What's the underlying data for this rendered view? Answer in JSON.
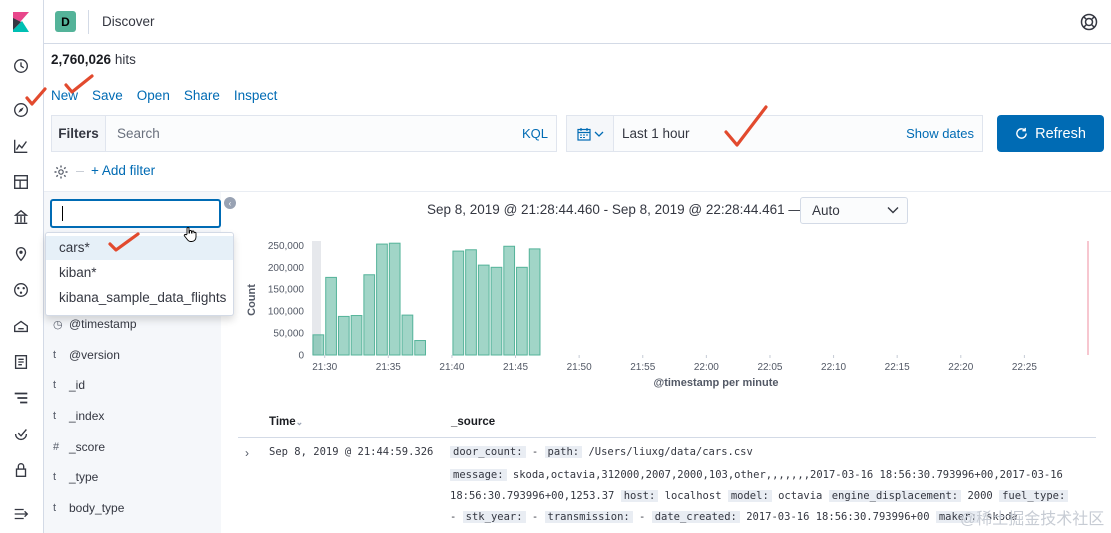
{
  "header": {
    "space_initial": "D",
    "title": "Discover"
  },
  "hits": {
    "count": "2,760,026",
    "label": "hits"
  },
  "menu": {
    "new": "New",
    "save": "Save",
    "open": "Open",
    "share": "Share",
    "inspect": "Inspect"
  },
  "query": {
    "filters_label": "Filters",
    "placeholder": "Search",
    "kql": "KQL"
  },
  "time": {
    "value": "Last 1 hour",
    "show_dates": "Show dates",
    "refresh": "Refresh"
  },
  "add_filter": "+ Add filter",
  "index_popover": {
    "options": [
      "cars*",
      "kiban*",
      "kibana_sample_data_flights"
    ]
  },
  "fields": [
    {
      "type": "◷",
      "name": "@timestamp"
    },
    {
      "type": "t",
      "name": "@version"
    },
    {
      "type": "t",
      "name": "_id"
    },
    {
      "type": "t",
      "name": "_index"
    },
    {
      "type": "#",
      "name": "_score"
    },
    {
      "type": "t",
      "name": "_type"
    },
    {
      "type": "t",
      "name": "body_type"
    }
  ],
  "histogram": {
    "date_range": "Sep 8, 2019 @ 21:28:44.460 - Sep 8, 2019 @ 22:28:44.461 —",
    "interval": "Auto"
  },
  "chart_data": {
    "type": "bar",
    "xlabel": "@timestamp per minute",
    "ylabel": "Count",
    "ylim": [
      0,
      260000
    ],
    "yticks": [
      0,
      50000,
      100000,
      150000,
      200000,
      250000
    ],
    "ytick_labels": [
      "0",
      "50,000",
      "100,000",
      "150,000",
      "200,000",
      "250,000"
    ],
    "xtick_labels": [
      "21:30",
      "21:35",
      "21:40",
      "21:45",
      "21:50",
      "21:55",
      "22:00",
      "22:05",
      "22:10",
      "22:15",
      "22:20",
      "22:25"
    ],
    "x_minutes_start": "21:29",
    "values": [
      46000,
      177000,
      88000,
      90000,
      183000,
      253000,
      255000,
      91000,
      33000,
      0,
      0,
      237000,
      240000,
      205000,
      200000,
      248000,
      200000,
      242000
    ],
    "color": "#54b399"
  },
  "table": {
    "columns": [
      "Time",
      "_source"
    ],
    "rows": [
      {
        "time": "Sep 8, 2019 @ 21:44:59.326",
        "line1": [
          [
            "door_count:",
            " - "
          ],
          [
            "path:",
            " /Users/liuxg/data/cars.csv"
          ]
        ],
        "line2": [
          [
            "message:",
            " skoda,octavia,312000,2007,2000,103,other,,,,,,,2017-03-16 18:56:30.793996+00,2017-03-16"
          ]
        ],
        "line3": [
          [
            "",
            "18:56:30.793996+00,1253.37 "
          ],
          [
            "host:",
            " localhost "
          ],
          [
            "model:",
            " octavia "
          ],
          [
            "engine_displacement:",
            " 2000 "
          ],
          [
            "fuel_type:",
            ""
          ]
        ],
        "line4": [
          [
            "",
            " - "
          ],
          [
            "stk_year:",
            " - "
          ],
          [
            "transmission:",
            " - "
          ],
          [
            "date_created:",
            " 2017-03-16 18:56:30.793996+00 "
          ],
          [
            "maker:",
            " skoda"
          ]
        ]
      }
    ]
  },
  "watermark": "@稀土掘金技术社区"
}
